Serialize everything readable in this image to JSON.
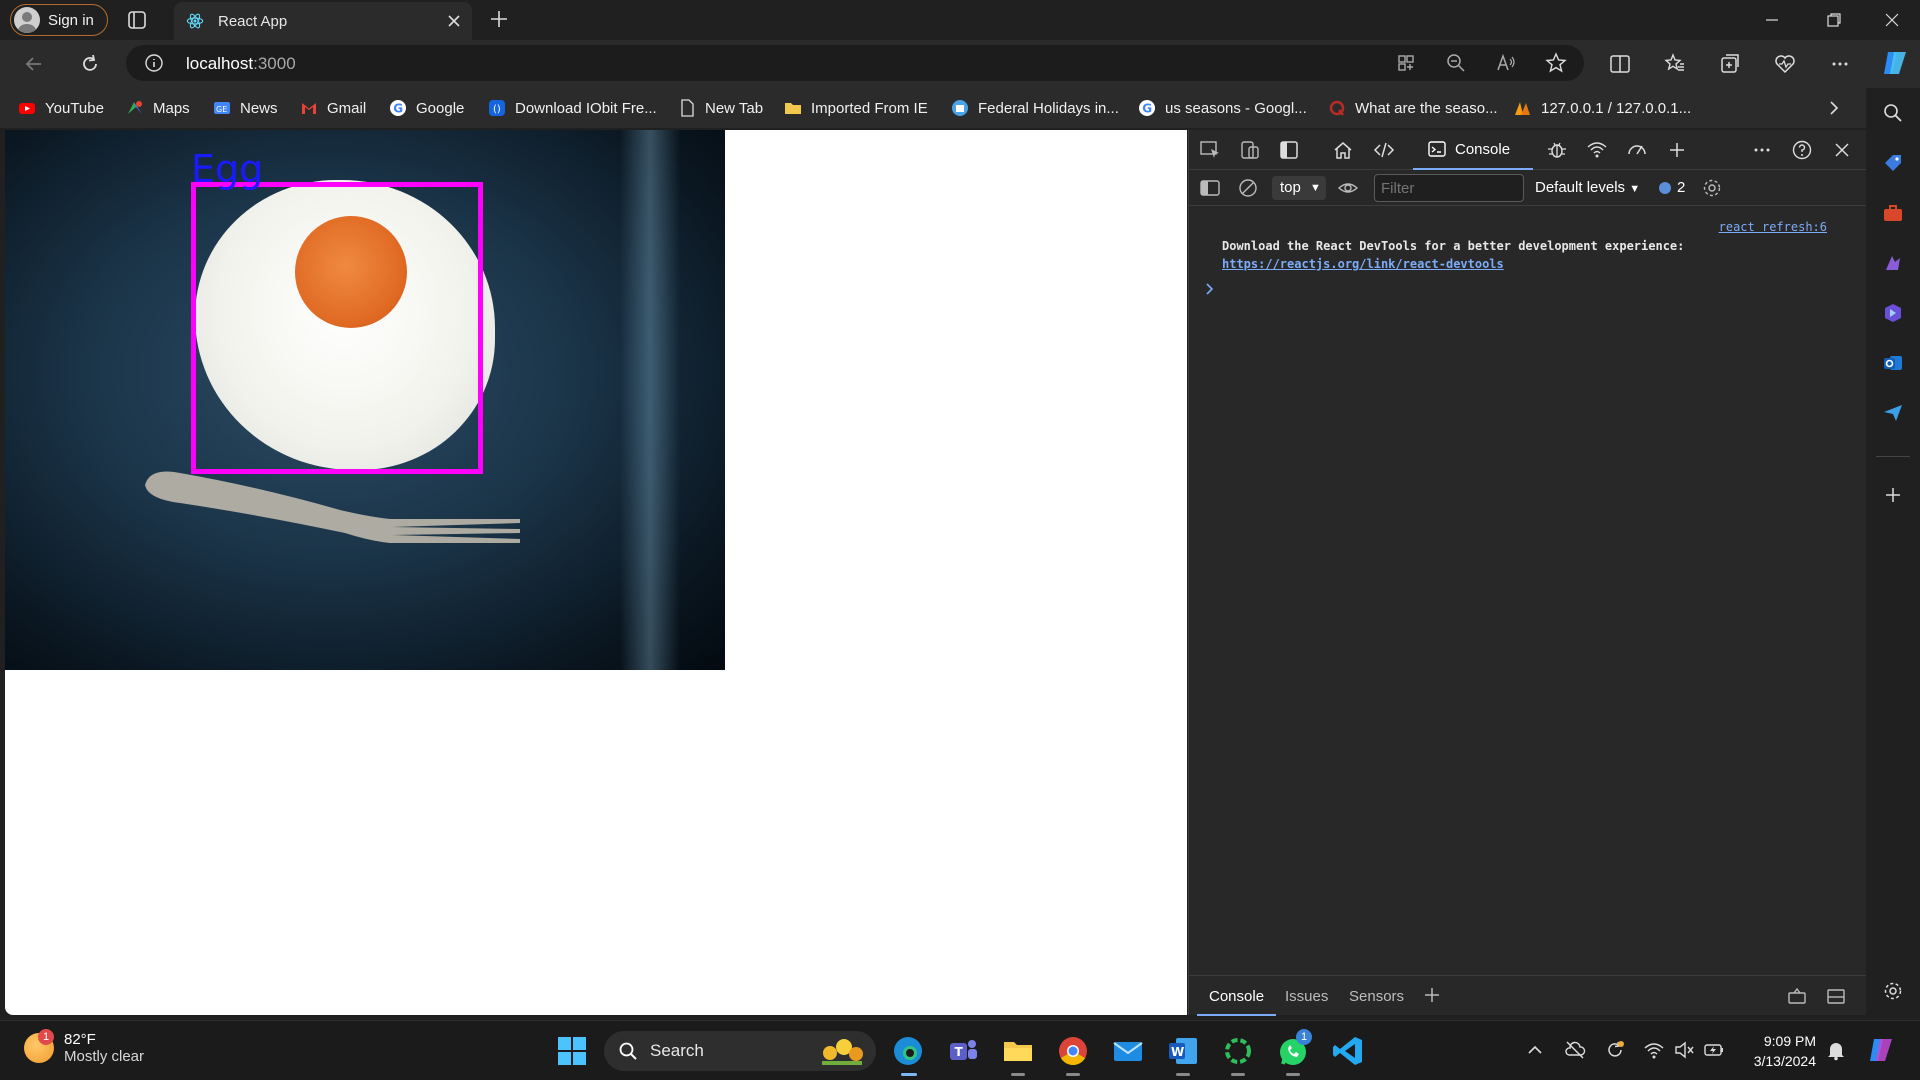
{
  "browser": {
    "signin_label": "Sign in",
    "tab_title": "React App",
    "url_host": "localhost",
    "url_port": ":3000"
  },
  "bookmarks": [
    {
      "label": "YouTube",
      "icon": "youtube-icon"
    },
    {
      "label": "Maps",
      "icon": "maps-icon"
    },
    {
      "label": "News",
      "icon": "news-icon"
    },
    {
      "label": "Gmail",
      "icon": "gmail-icon"
    },
    {
      "label": "Google",
      "icon": "google-icon"
    },
    {
      "label": "Download IObit Fre...",
      "icon": "iobit-icon"
    },
    {
      "label": "New Tab",
      "icon": "page-icon"
    },
    {
      "label": "Imported From IE",
      "icon": "folder-icon"
    },
    {
      "label": "Federal Holidays in...",
      "icon": "calendar-icon"
    },
    {
      "label": "us seasons - Googl...",
      "icon": "google-icon"
    },
    {
      "label": "What are the seaso...",
      "icon": "quora-icon"
    },
    {
      "label": "127.0.0.1 / 127.0.0.1...",
      "icon": "phpmyadmin-icon"
    }
  ],
  "page": {
    "detection_label": "Egg",
    "box_color": "#ff00ff",
    "label_color": "#1a1aff"
  },
  "devtools": {
    "console_tab": "Console",
    "context": "top",
    "filter_placeholder": "Filter",
    "levels": "Default levels",
    "issues_count": "2",
    "source_link": "react refresh:6",
    "message_text": "Download the React DevTools for a better development experience: ",
    "message_link": "https://reactjs.org/link/react-devtools",
    "drawer_tabs": [
      "Console",
      "Issues",
      "Sensors"
    ]
  },
  "taskbar": {
    "temperature": "82°F",
    "weather_desc": "Mostly clear",
    "weather_badge": "1",
    "search_label": "Search",
    "time": "9:09 PM",
    "date": "3/13/2024",
    "whatsapp_badge": "1"
  }
}
